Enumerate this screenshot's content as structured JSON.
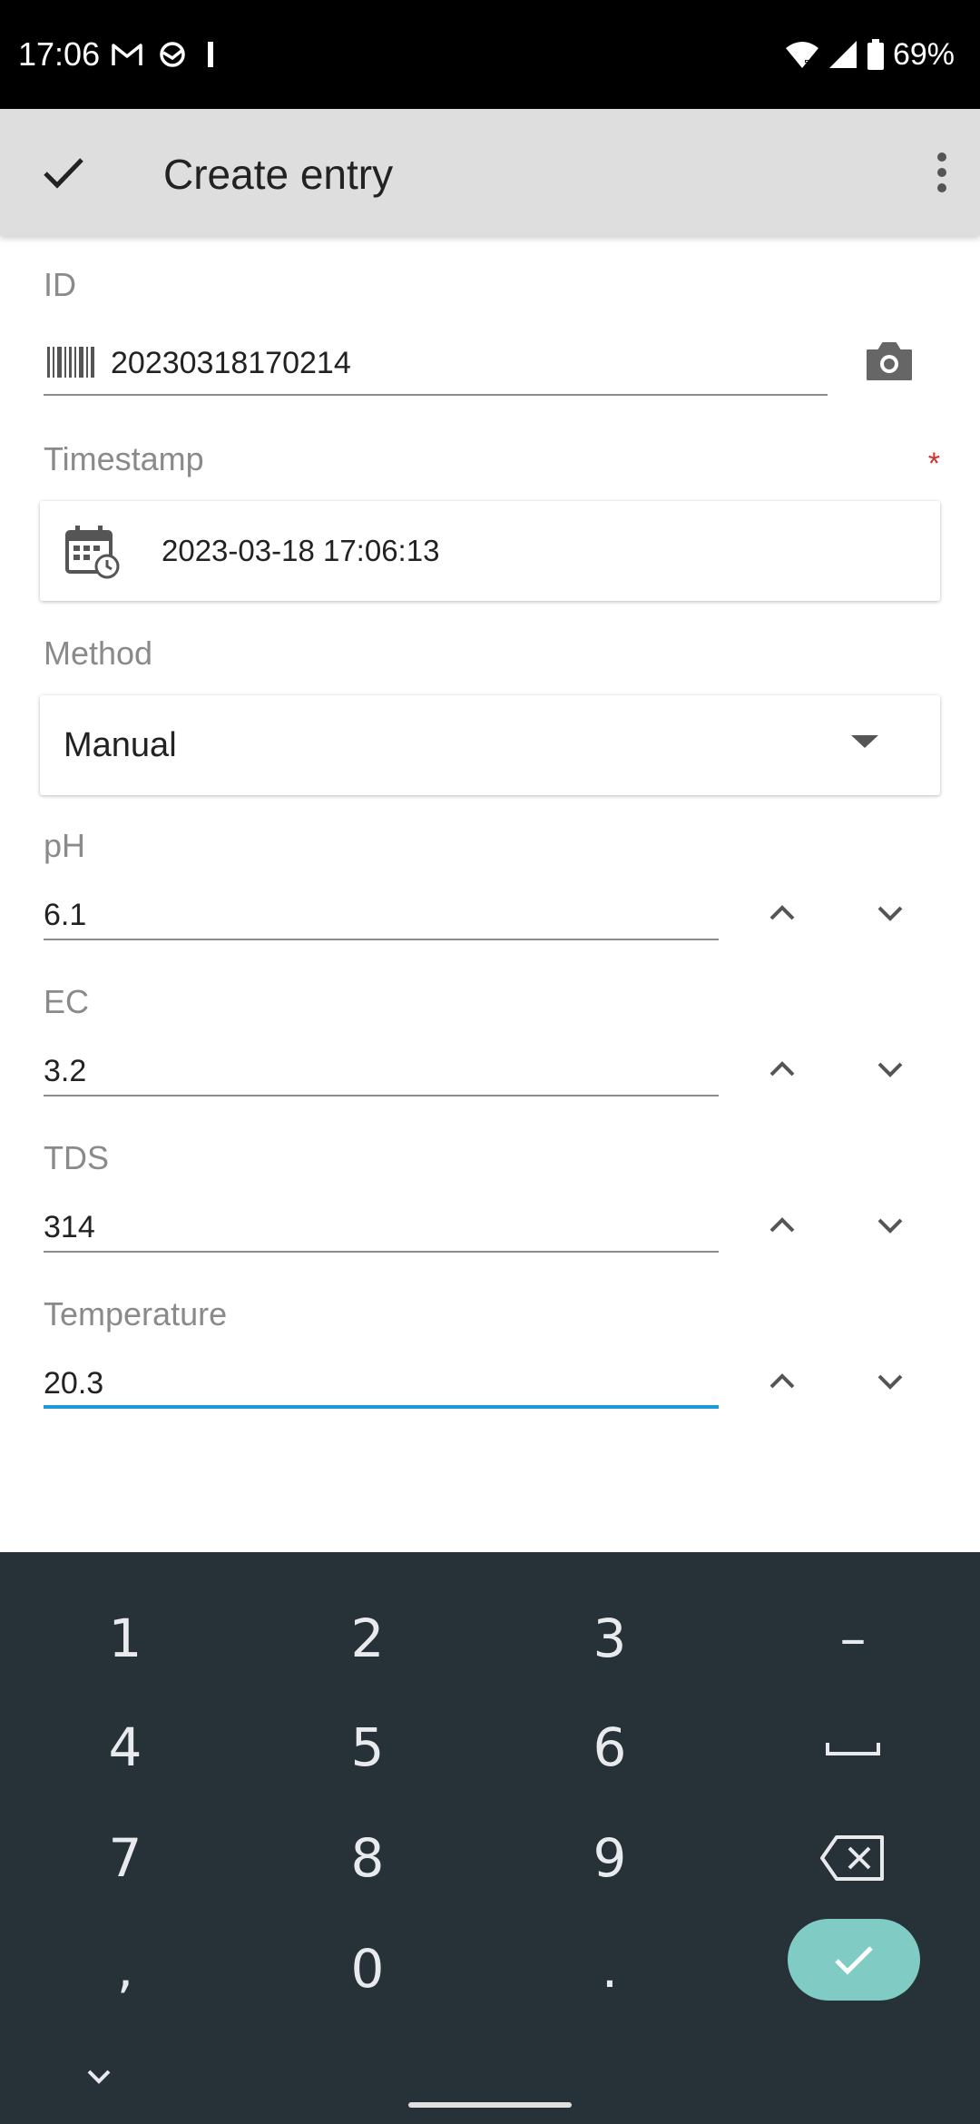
{
  "status_bar": {
    "time": "17:06",
    "battery": "69%",
    "icons": [
      "gmail-icon",
      "sync-icon",
      "signal-bar-icon",
      "wifi-icon",
      "cell-signal-icon",
      "battery-icon"
    ]
  },
  "app_bar": {
    "title": "Create entry",
    "icons": [
      "check-icon",
      "more-vert-icon"
    ]
  },
  "form": {
    "id": {
      "label": "ID",
      "value": "20230318170214"
    },
    "timestamp": {
      "label": "Timestamp",
      "required_mark": "*",
      "value": "2023-03-18 17:06:13"
    },
    "method": {
      "label": "Method",
      "value": "Manual"
    },
    "fields": [
      {
        "label": "pH",
        "value": "6.1"
      },
      {
        "label": "EC",
        "value": "3.2"
      },
      {
        "label": "TDS",
        "value": "314"
      },
      {
        "label": "Temperature",
        "value": "20.3"
      }
    ]
  },
  "keyboard": {
    "keys": [
      "1",
      "2",
      "3",
      "–",
      "4",
      "5",
      "6",
      "7",
      "8",
      "9",
      ",",
      "0",
      "."
    ],
    "special_keys": [
      "space-icon",
      "backspace-icon",
      "enter-check-icon",
      "hide-keyboard-icon"
    ]
  },
  "colors": {
    "status_bar": "#000000",
    "app_bar": "#dedede",
    "accent": "#1e9ad6",
    "required": "#d32f2f",
    "keyboard_bg": "#263238",
    "enter_key": "#80cbc4"
  }
}
